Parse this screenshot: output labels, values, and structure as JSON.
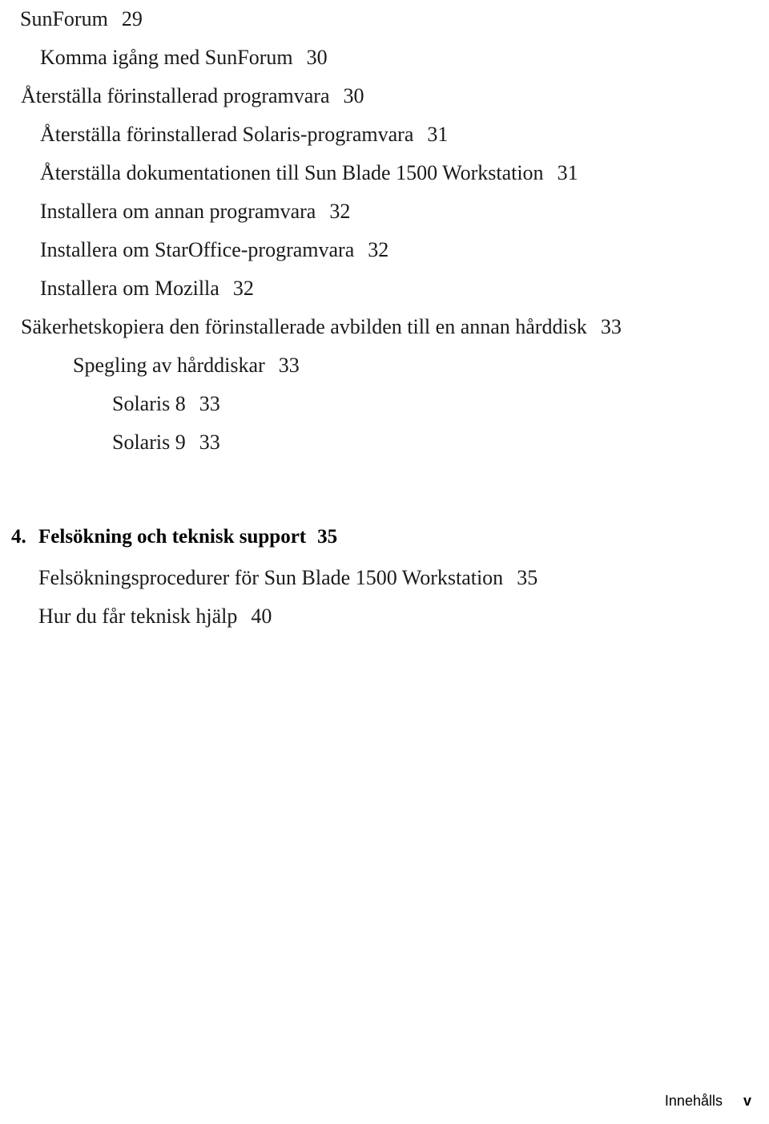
{
  "document": {
    "type": "table-of-contents",
    "language": "sv"
  },
  "entries": [
    {
      "indent": 1,
      "title": "SunForum",
      "page": "29"
    },
    {
      "indent": 2,
      "title": "Komma igång med SunForum",
      "page": "30"
    },
    {
      "indent": 1,
      "title": "Återställa förinstallerad programvara",
      "page": "30"
    },
    {
      "indent": 2,
      "title": "Återställa förinstallerad Solaris-programvara",
      "page": "31"
    },
    {
      "indent": 2,
      "title": "Återställa dokumentationen till Sun Blade 1500 Workstation",
      "page": "31"
    },
    {
      "indent": 2,
      "title": "Installera om annan programvara",
      "page": "32"
    },
    {
      "indent": 2,
      "title": "Installera om StarOffice-programvara",
      "page": "32"
    },
    {
      "indent": 2,
      "title": "Installera om Mozilla",
      "page": "32"
    },
    {
      "indent": 1,
      "title": "Säkerhetskopiera den förinstallerade avbilden till en annan hårddisk",
      "page": "33"
    },
    {
      "indent": 2,
      "title": "Spegling av hårddiskar",
      "page": "33"
    },
    {
      "indent": 3,
      "title": "Solaris 8",
      "page": "33"
    },
    {
      "indent": 3,
      "title": "Solaris 9",
      "page": "33"
    }
  ],
  "chapter": {
    "number": "4.",
    "title": "Felsökning och teknisk support",
    "page": "35",
    "entries": [
      {
        "title": "Felsökningsprocedurer för Sun Blade 1500 Workstation",
        "page": "35"
      },
      {
        "title": "Hur du får teknisk hjälp",
        "page": "40"
      }
    ]
  },
  "footer": {
    "label": "Innehålls",
    "page": "v"
  }
}
